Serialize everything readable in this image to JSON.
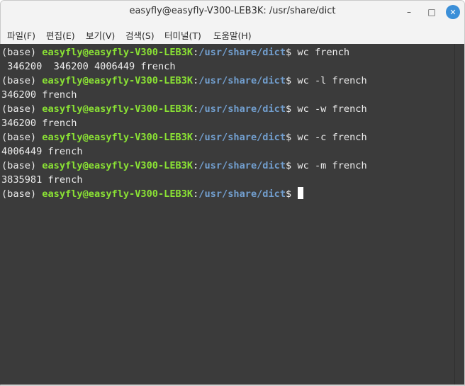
{
  "window": {
    "title": "easyfly@easyfly-V300-LEB3K: /usr/share/dict",
    "controls": {
      "minimize": "–",
      "maximize": "□",
      "close": "✕"
    }
  },
  "menubar": {
    "items": [
      "파일(F)",
      "편집(E)",
      "보기(V)",
      "검색(S)",
      "터미널(T)",
      "도움말(H)"
    ]
  },
  "terminal": {
    "prompt": {
      "env": "(base) ",
      "user_host": "easyfly@easyfly-V300-LEB3K",
      "colon": ":",
      "path": "/usr/share/dict",
      "symbol": "$ "
    },
    "commands": [
      "wc french",
      "wc -l french",
      "wc -w french",
      "wc -c french",
      "wc -m french"
    ],
    "outputs": [
      " 346200  346200 4006449 french",
      "346200 french",
      "346200 french",
      "4006449 french",
      "3835981 french"
    ]
  },
  "colors": {
    "background": "#3b3b3b",
    "foreground": "#ededed",
    "user_host": "#8ae234",
    "path": "#729fcf",
    "close_button": "#3b8fd8"
  }
}
